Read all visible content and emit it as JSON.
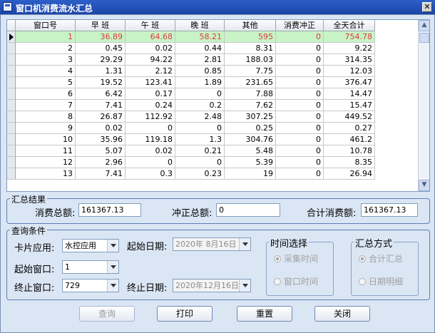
{
  "window": {
    "title": "窗口机消费流水汇总",
    "close_glyph": "✕"
  },
  "grid": {
    "columns": [
      "窗口号",
      "早 班",
      "午 班",
      "晚 班",
      "其他",
      "消费冲正",
      "全天合计"
    ],
    "rows": [
      [
        "1",
        "36.89",
        "64.68",
        "58.21",
        "595",
        "0",
        "754.78"
      ],
      [
        "2",
        "0.45",
        "0.02",
        "0.44",
        "8.31",
        "0",
        "9.22"
      ],
      [
        "3",
        "29.29",
        "94.22",
        "2.81",
        "188.03",
        "0",
        "314.35"
      ],
      [
        "4",
        "1.31",
        "2.12",
        "0.85",
        "7.75",
        "0",
        "12.03"
      ],
      [
        "5",
        "19.52",
        "123.41",
        "1.89",
        "231.65",
        "0",
        "376.47"
      ],
      [
        "6",
        "6.42",
        "0.17",
        "0",
        "7.88",
        "0",
        "14.47"
      ],
      [
        "7",
        "7.41",
        "0.24",
        "0.2",
        "7.62",
        "0",
        "15.47"
      ],
      [
        "8",
        "26.87",
        "112.92",
        "2.48",
        "307.25",
        "0",
        "449.52"
      ],
      [
        "9",
        "0.02",
        "0",
        "0",
        "0.25",
        "0",
        "0.27"
      ],
      [
        "10",
        "35.96",
        "119.18",
        "1.3",
        "304.76",
        "0",
        "461.2"
      ],
      [
        "11",
        "5.07",
        "0.02",
        "0.21",
        "5.48",
        "0",
        "10.78"
      ],
      [
        "12",
        "2.96",
        "0",
        "0",
        "5.39",
        "0",
        "8.35"
      ],
      [
        "13",
        "7.41",
        "0.3",
        "0.23",
        "19",
        "0",
        "26.94"
      ]
    ],
    "selected_row_index": 0
  },
  "summary": {
    "title": "汇总结果",
    "total_label": "消费总额:",
    "total_value": "161367.13",
    "reversal_label": "冲正总额:",
    "reversal_value": "0",
    "grand_label": "合计消费额:",
    "grand_value": "161367.13"
  },
  "query": {
    "title": "查询条件",
    "card_app_label": "卡片应用:",
    "card_app_value": "水控应用",
    "start_window_label": "起始窗口:",
    "start_window_value": "1",
    "end_window_label": "终止窗口:",
    "end_window_value": "729",
    "start_date_label": "起始日期:",
    "start_date_value": "2020年 8月16日",
    "end_date_label": "终止日期:",
    "end_date_value": "2020年12月16日",
    "time_group": {
      "title": "时间选择",
      "option1": "采集时间",
      "option2": "窗口时间"
    },
    "summary_group": {
      "title": "汇总方式",
      "option1": "合计汇总",
      "option2": "日期明细"
    }
  },
  "buttons": {
    "query": "查询",
    "print": "打印",
    "reset": "重置",
    "close": "关闭"
  },
  "colors": {
    "selected_row_bg": "#c8f3c6",
    "selected_row_text": "#e23a3a",
    "titlebar": "#2d5fc8"
  }
}
